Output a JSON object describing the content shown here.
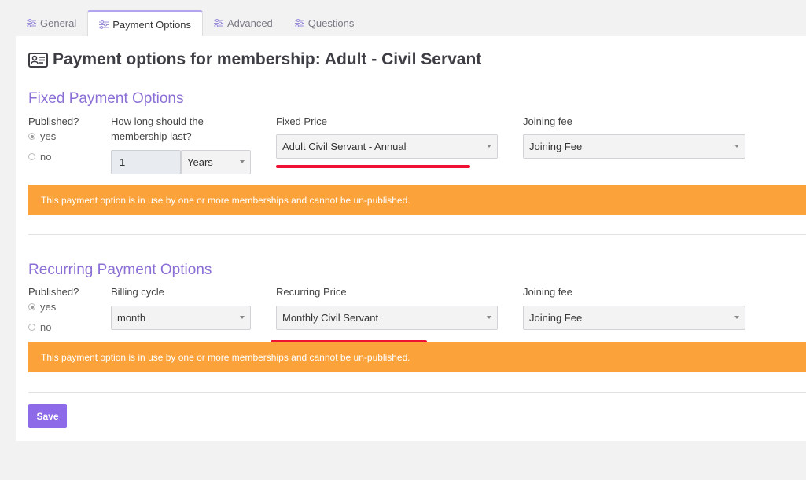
{
  "tabs": [
    {
      "label": "General",
      "icon": "sliders-icon",
      "active": false
    },
    {
      "label": "Payment Options",
      "icon": "sliders-icon",
      "active": true
    },
    {
      "label": "Advanced",
      "icon": "sliders-icon",
      "active": false
    },
    {
      "label": "Questions",
      "icon": "sliders-icon",
      "active": false
    }
  ],
  "page_title": "Payment options for membership: Adult - Civil Servant",
  "page_icon": "id-card-icon",
  "fixed": {
    "title": "Fixed Payment Options",
    "published_label": "Published?",
    "yes_label": "yes",
    "no_label": "no",
    "published": "yes",
    "duration_label": "How long should the membership last?",
    "duration_value": "1",
    "duration_unit": "Years",
    "price_label": "Fixed Price",
    "price_value": "Adult Civil Servant - Annual",
    "joining_fee_label": "Joining fee",
    "joining_fee_value": "Joining Fee",
    "alert": "This payment option is in use by one or more memberships and cannot be un-published."
  },
  "recurring": {
    "title": "Recurring Payment Options",
    "published_label": "Published?",
    "yes_label": "yes",
    "no_label": "no",
    "published": "yes",
    "billing_label": "Billing cycle",
    "billing_value": "month",
    "price_label": "Recurring Price",
    "price_value": "Monthly Civil Servant",
    "joining_fee_label": "Joining fee",
    "joining_fee_value": "Joining Fee",
    "alert": "This payment option is in use by one or more memberships and cannot be un-published."
  },
  "save_label": "Save",
  "colors": {
    "accent": "#8b6fd6",
    "button": "#8d6be8",
    "alert": "#fba23a",
    "annotation": "#ee1133"
  }
}
